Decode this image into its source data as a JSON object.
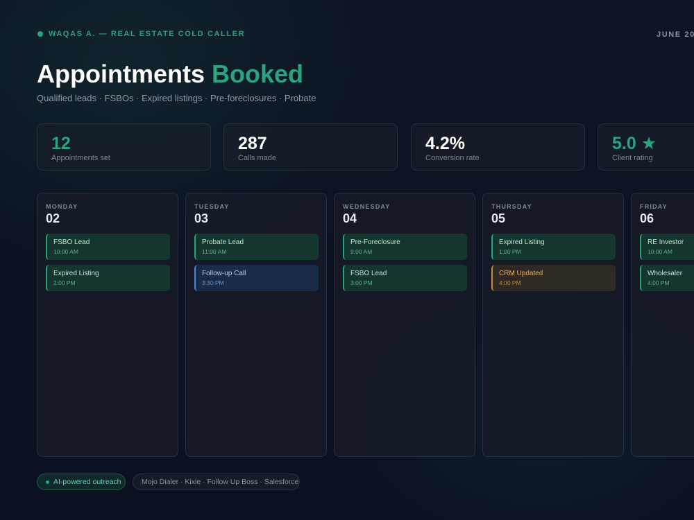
{
  "header": {
    "brand": "WAQAS A. — REAL ESTATE COLD CALLER",
    "date_label": "JUNE 20",
    "title_main": "Appointments",
    "title_accent": "Booked",
    "subtitle": "Qualified leads · FSBOs · Expired listings · Pre-foreclosures · Probate"
  },
  "stats": [
    {
      "value": "12",
      "label": "Appointments set"
    },
    {
      "value": "287",
      "label": "Calls made"
    },
    {
      "value": "4.2%",
      "label": "Conversion rate"
    },
    {
      "value": "5.0 ★",
      "label": "Client rating"
    }
  ],
  "days": [
    {
      "name": "MONDAY",
      "num": "02",
      "events": [
        {
          "title": "FSBO Lead",
          "time": "10:00 AM",
          "type": "green"
        },
        {
          "title": "Expired Listing",
          "time": "2:00 PM",
          "type": "green"
        }
      ]
    },
    {
      "name": "TUESDAY",
      "num": "03",
      "events": [
        {
          "title": "Probate Lead",
          "time": "11:00 AM",
          "type": "green"
        },
        {
          "title": "Follow-up Call",
          "time": "3:30 PM",
          "type": "blue"
        }
      ]
    },
    {
      "name": "WEDNESDAY",
      "num": "04",
      "events": [
        {
          "title": "Pre-Foreclosure",
          "time": "9:00 AM",
          "type": "green"
        },
        {
          "title": "FSBO Lead",
          "time": "3:00 PM",
          "type": "green"
        }
      ]
    },
    {
      "name": "THURSDAY",
      "num": "05",
      "events": [
        {
          "title": "Expired Listing",
          "time": "1:00 PM",
          "type": "green"
        },
        {
          "title": "CRM Updated",
          "time": "4:00 PM",
          "type": "amber"
        }
      ]
    },
    {
      "name": "FRIDAY",
      "num": "06",
      "events": [
        {
          "title": "RE Investor",
          "time": "10:00 AM",
          "type": "green"
        },
        {
          "title": "Wholesaler",
          "time": "4:00 PM",
          "type": "green"
        }
      ]
    }
  ],
  "footer": {
    "ai_label": "AI-powered outreach",
    "tools_label": "Mojo Dialer · Kixie · Follow Up Boss · Salesforce"
  },
  "colors": {
    "accent": "#2aa37f",
    "background": "#0c1220",
    "blue": "#4a86d8",
    "amber": "#c98a3a"
  }
}
